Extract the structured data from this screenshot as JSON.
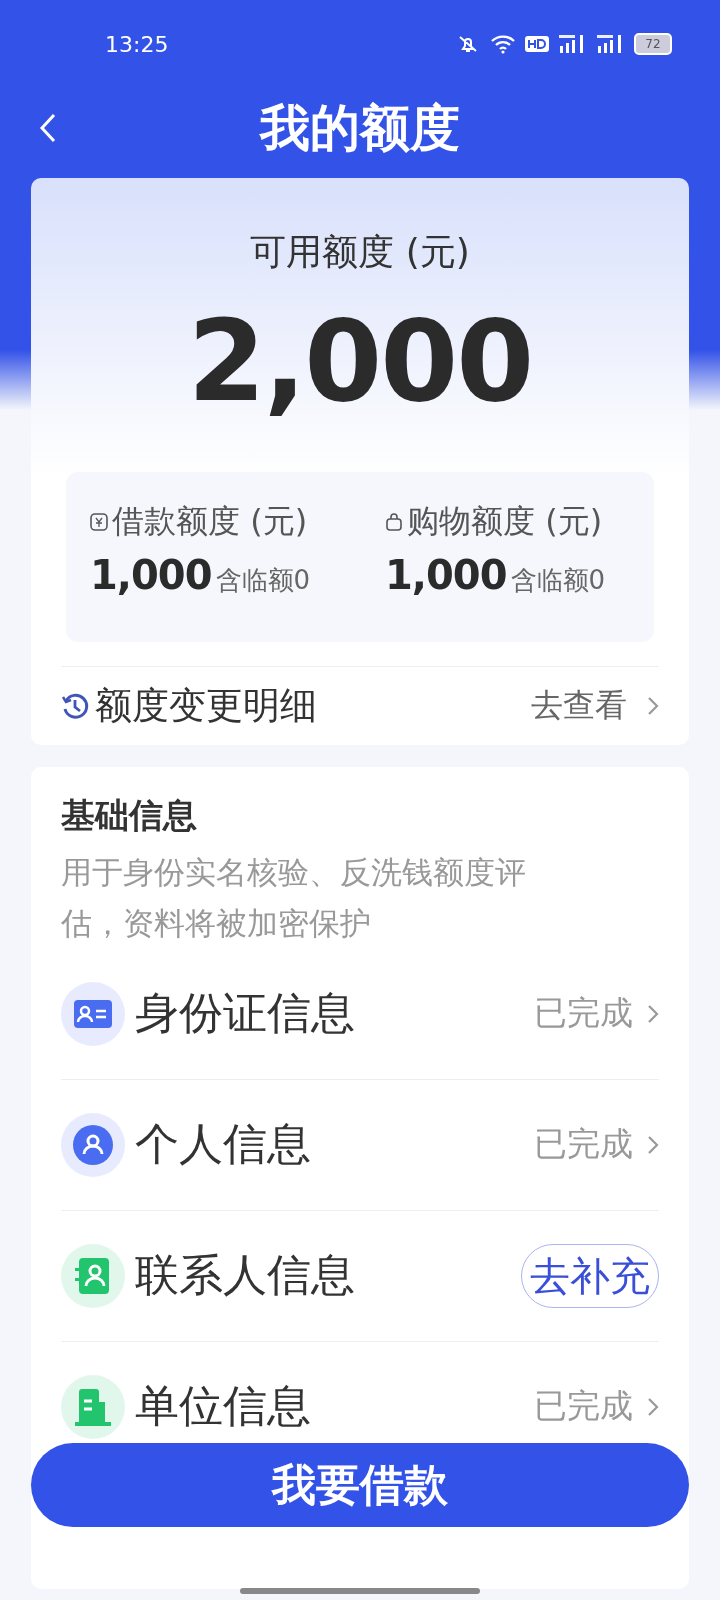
{
  "status_bar": {
    "time": "13:25",
    "battery": "72"
  },
  "header": {
    "title": "我的额度"
  },
  "quota_card": {
    "label": "可用额度 (元)",
    "amount": "2,000",
    "parts": [
      {
        "label": "借款额度 (元)",
        "amount": "1,000",
        "note": "含临额0"
      },
      {
        "label": "购物额度 (元)",
        "amount": "1,000",
        "note": "含临额0"
      }
    ],
    "history": {
      "label": "额度变更明细",
      "action": "去查看"
    }
  },
  "basic_info": {
    "title": "基础信息",
    "description": "用于身份实名核验、反洗钱额度评估，资料将被加密保护",
    "items": [
      {
        "name": "身份证信息",
        "status": "已完成",
        "kind": "done",
        "color": "#4a6cf0"
      },
      {
        "name": "个人信息",
        "status": "已完成",
        "kind": "done",
        "color": "#4a6cf0"
      },
      {
        "name": "联系人信息",
        "status": "去补充",
        "kind": "todo",
        "color": "#22c46e"
      },
      {
        "name": "单位信息",
        "status": "已完成",
        "kind": "done",
        "color": "#22c46e"
      }
    ]
  },
  "primary_button": "我要借款"
}
